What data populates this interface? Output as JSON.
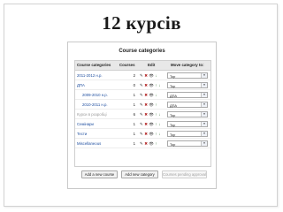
{
  "slide": {
    "title": "12 курсів"
  },
  "panel": {
    "title": "Course categories"
  },
  "table": {
    "headers": {
      "categories": "Course categories",
      "courses": "Courses",
      "edit": "Edit",
      "move": "Move category to:"
    },
    "edit_icons": {
      "edit": "✎",
      "delete": "✖",
      "visibility": "👁",
      "up": "↑",
      "down": "↓",
      "icon_names": [
        "edit-icon",
        "delete-icon",
        "visibility-icon",
        "move-up-icon",
        "move-down-icon"
      ]
    },
    "rows": [
      {
        "name": "2011-2012 н.р.",
        "courses": "2",
        "move_to": "Top",
        "hidden": false
      },
      {
        "name": "ДПА",
        "courses": "0",
        "move_to": "Top",
        "hidden": false
      },
      {
        "name": "2009-2010 н.р.",
        "courses": "1",
        "move_to": "ДПА",
        "hidden": false
      },
      {
        "name": "2010-2011 н.р.",
        "courses": "1",
        "move_to": "ДПА",
        "hidden": false
      },
      {
        "name": "Курси в розробці",
        "courses": "6",
        "move_to": "Top",
        "hidden": true
      },
      {
        "name": "Семінари",
        "courses": "1",
        "move_to": "Top",
        "hidden": false
      },
      {
        "name": "Тести",
        "courses": "1",
        "move_to": "Top",
        "hidden": false
      },
      {
        "name": "Miscellaneous",
        "courses": "1",
        "move_to": "Top",
        "hidden": false
      }
    ]
  },
  "buttons": {
    "add_course": "Add a new course",
    "add_category": "Add new category",
    "pending": "Courses pending approval"
  },
  "colors": {
    "link": "#1f4fa0",
    "header_bg": "#e8e8e8",
    "disabled_text": "#a0a0a0"
  }
}
